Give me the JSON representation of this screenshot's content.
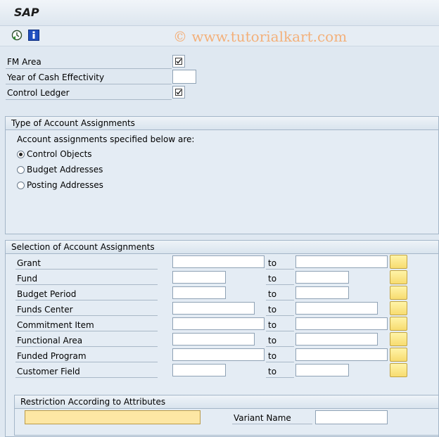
{
  "app": {
    "title": "SAP",
    "watermark": "© www.tutorialkart.com"
  },
  "toolbar": {
    "icons": [
      "execute-icon",
      "info-icon"
    ]
  },
  "top_fields": [
    {
      "label": "FM Area",
      "checked": true
    },
    {
      "label": "Year of Cash Effectivity",
      "value": ""
    },
    {
      "label": "Control Ledger",
      "checked": true
    }
  ],
  "type_group": {
    "title": "Type of Account Assignments",
    "prompt": "Account assignments specified below are:",
    "options": [
      "Control Objects",
      "Budget Addresses",
      "Posting Addresses"
    ],
    "selected": "Control Objects"
  },
  "selection_group": {
    "title": "Selection of Account Assignments",
    "to_label": "to",
    "rows": [
      {
        "label": "Grant"
      },
      {
        "label": "Fund"
      },
      {
        "label": "Budget Period"
      },
      {
        "label": "Funds Center"
      },
      {
        "label": "Commitment Item"
      },
      {
        "label": "Functional Area"
      },
      {
        "label": "Funded Program"
      },
      {
        "label": "Customer Field"
      }
    ]
  },
  "restriction_group": {
    "title": "Restriction According to Attributes",
    "variant_label": "Variant Name"
  },
  "colors": {
    "accent": "#f7dc70",
    "background": "#dfe8f1",
    "watermark": "#f3b07a"
  }
}
